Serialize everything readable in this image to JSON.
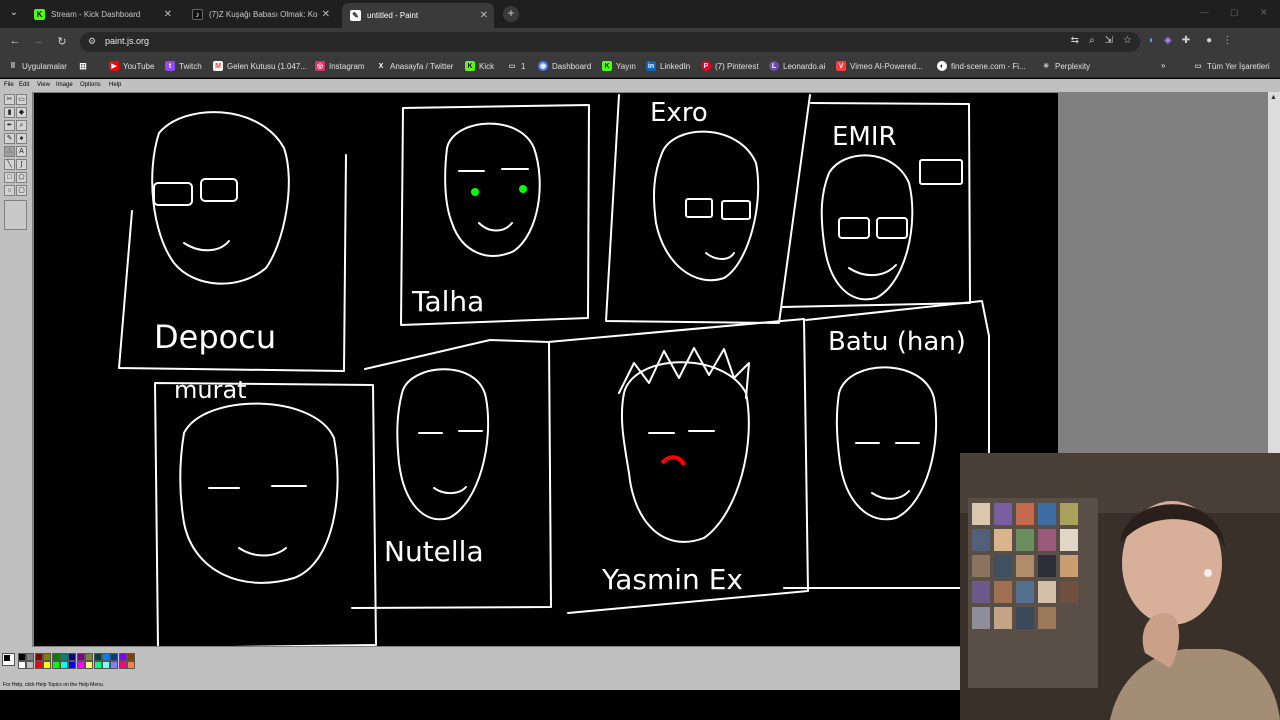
{
  "browser": {
    "tabs": [
      {
        "title": "Stream - Kick Dashboard",
        "icon": "kick-icon",
        "icon_color": "#53fc18",
        "active": false
      },
      {
        "title": "(7)Z Kuşağı Babası Olmak: Kom...",
        "icon": "tiktok-icon",
        "icon_color": "#000000",
        "active": false
      },
      {
        "title": "untitled - Paint",
        "icon": "paint-icon",
        "icon_color": "#ffffff",
        "active": true
      }
    ],
    "url": "paint.js.org",
    "bookmarks": [
      {
        "label": "Uygulamalar",
        "icon": "apps-icon"
      },
      {
        "label": "YouTube",
        "icon": "youtube-icon",
        "color": "#ff0000"
      },
      {
        "label": "Twitch",
        "icon": "twitch-icon",
        "color": "#9146ff"
      },
      {
        "label": "Gelen Kutusu (1.047...",
        "icon": "gmail-icon",
        "color": "#ea4335"
      },
      {
        "label": "Instagram",
        "icon": "instagram-icon",
        "color": "#e1306c"
      },
      {
        "label": "Anasayfa / Twitter",
        "icon": "x-icon",
        "color": "#ffffff"
      },
      {
        "label": "Kick",
        "icon": "kick-icon",
        "color": "#53fc18"
      },
      {
        "label": "1",
        "icon": "folder-icon"
      },
      {
        "label": "Dashboard",
        "icon": "dashboard-icon",
        "color": "#4a7cff"
      },
      {
        "label": "Yayın",
        "icon": "kick-icon",
        "color": "#53fc18"
      },
      {
        "label": "LinkedIn",
        "icon": "linkedin-icon",
        "color": "#0a66c2"
      },
      {
        "label": "(7) Pinterest",
        "icon": "pinterest-icon",
        "color": "#e60023"
      },
      {
        "label": "Leonardo.ai",
        "icon": "leonardo-icon",
        "color": "#b58cff"
      },
      {
        "label": "Vimeo AI-Powered...",
        "icon": "vimeo-icon",
        "color": "#ff3b3b"
      },
      {
        "label": "find-scene.com - Fi...",
        "icon": "findscene-icon",
        "color": "#ffffff"
      },
      {
        "label": "Perplexity",
        "icon": "perplexity-icon",
        "color": "#cccccc"
      }
    ],
    "all_bookmarks": "Tüm Yer İşaretleri"
  },
  "paint": {
    "menu": [
      "File",
      "Edit",
      "View",
      "Image",
      "Options",
      "Help"
    ],
    "status": "For Help, click Help Topics on the Help Menu.",
    "palette": [
      "#000000",
      "#808080",
      "#800000",
      "#808000",
      "#008000",
      "#008080",
      "#000080",
      "#800080",
      "#808040",
      "#004040",
      "#0080ff",
      "#004080",
      "#8000ff",
      "#804000",
      "#ffffff",
      "#c0c0c0",
      "#ff0000",
      "#ffff00",
      "#00ff00",
      "#00ffff",
      "#0000ff",
      "#ff00ff",
      "#ffff80",
      "#00ff80",
      "#80ffff",
      "#8080ff",
      "#ff0080",
      "#ff8040"
    ]
  },
  "drawing": {
    "labels": {
      "depocu": "Depocu",
      "talha": "Talha",
      "exro": "Exro",
      "emir": "EMIR",
      "murat": "murat",
      "nutella": "Nutella",
      "yasmin": "Yasmin Ex",
      "batu": "Batu (han)"
    },
    "accent_green": "#00ff00",
    "accent_red": "#ff0000"
  }
}
